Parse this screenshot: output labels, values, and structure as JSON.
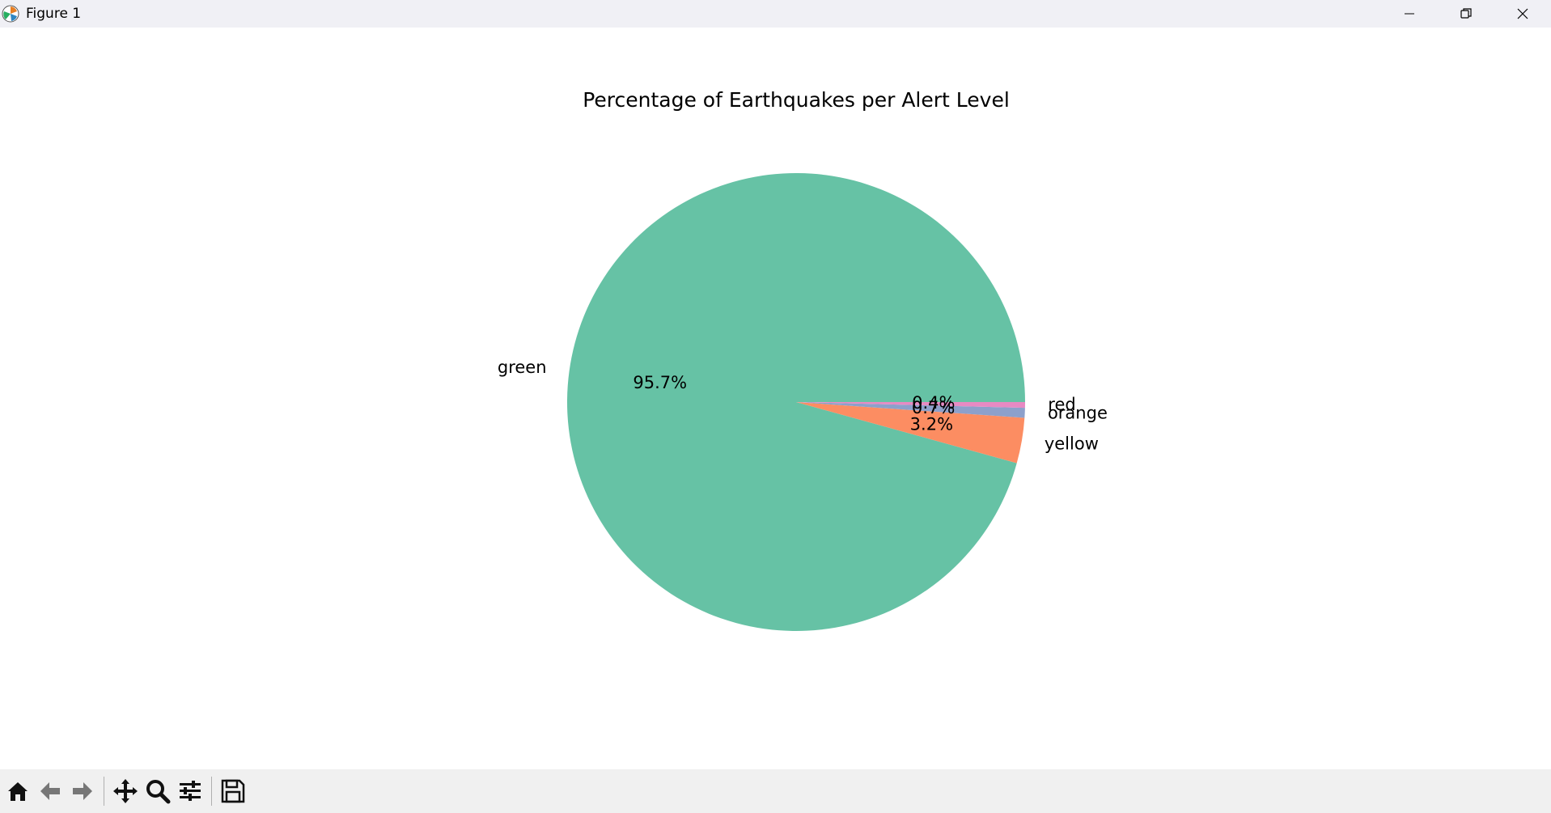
{
  "window": {
    "title": "Figure 1",
    "icons": {
      "app": "matplotlib-icon",
      "minimize": "minimize-icon",
      "maximize": "restore-icon",
      "close": "close-icon"
    }
  },
  "toolbar": {
    "items": [
      {
        "name": "home-icon"
      },
      {
        "name": "back-arrow-icon"
      },
      {
        "name": "forward-arrow-icon"
      },
      {
        "name": "pan-move-icon"
      },
      {
        "name": "zoom-magnifier-icon"
      },
      {
        "name": "configure-subplots-icon"
      },
      {
        "name": "save-figure-icon"
      }
    ]
  },
  "chart_data": {
    "type": "pie",
    "title": "Percentage of Earthquakes per Alert Level",
    "labels": [
      "green",
      "yellow",
      "orange",
      "red"
    ],
    "values": [
      95.7,
      3.2,
      0.7,
      0.4
    ],
    "autopct_labels": [
      "95.7%",
      "3.2%",
      "0.7%",
      "0.4%"
    ],
    "colors": [
      "#66c2a5",
      "#fc8d62",
      "#8da0cb",
      "#e78ac3"
    ],
    "startangle": 0,
    "counterclock": true
  }
}
